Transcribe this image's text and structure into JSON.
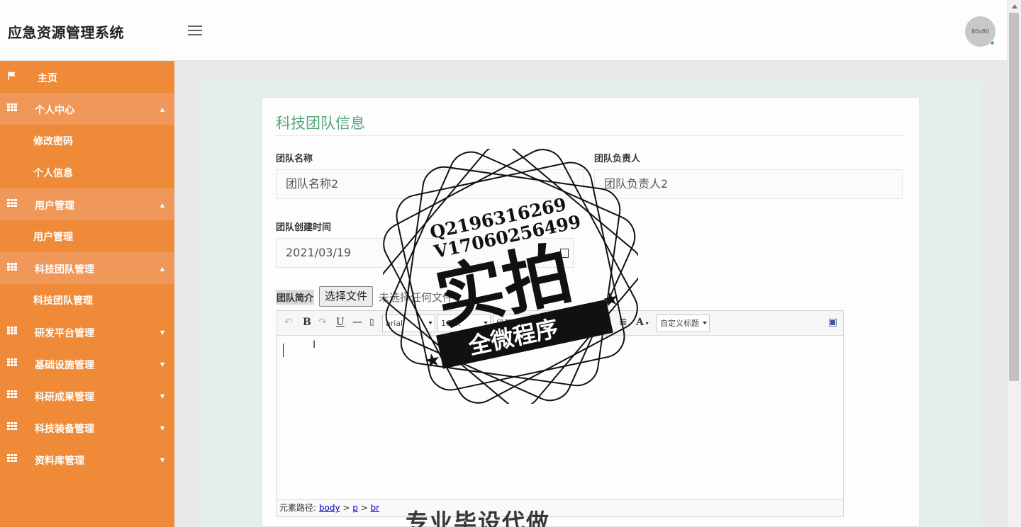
{
  "header": {
    "app_title": "应急资源管理系统",
    "avatar_text": "80x80"
  },
  "sidebar": {
    "items": [
      {
        "label": "主页",
        "icon": "flag-icon"
      },
      {
        "label": "个人中心",
        "icon": "grid-icon",
        "expanded": true,
        "children": [
          "修改密码",
          "个人信息"
        ]
      },
      {
        "label": "用户管理",
        "icon": "grid-icon",
        "expanded": true,
        "children": [
          "用户管理"
        ]
      },
      {
        "label": "科技团队管理",
        "icon": "grid-icon",
        "expanded": true,
        "children": [
          "科技团队管理"
        ]
      },
      {
        "label": "研发平台管理",
        "icon": "grid-icon"
      },
      {
        "label": "基础设施管理",
        "icon": "grid-icon"
      },
      {
        "label": "科研成果管理",
        "icon": "grid-icon"
      },
      {
        "label": "科技装备管理",
        "icon": "grid-icon"
      },
      {
        "label": "资料库管理",
        "icon": "grid-icon"
      }
    ]
  },
  "form": {
    "title": "科技团队信息",
    "team_name_label": "团队名称",
    "team_name_value": "团队名称2",
    "leader_label": "团队负责人",
    "leader_value": "团队负责人2",
    "created_label": "团队创建时间",
    "created_value": "2021/03/19",
    "intro_label": "团队简介",
    "file_button": "选择文件",
    "file_status": "未选择任何文件"
  },
  "editor": {
    "font_select": "arial",
    "size_select": "16px",
    "paragraph_select": "段落",
    "heading_select": "自定义标题",
    "path_label": "元素路径:",
    "path": [
      "body",
      "p",
      "br"
    ]
  },
  "watermark": {
    "line1": "Q2196316269",
    "line2": "V17060256499",
    "big": "实拍",
    "band": "全微程序",
    "bottom": "专业毕设代做"
  },
  "colors": {
    "sidebar": "#ee8a38",
    "accent_title": "#58a87a",
    "content_bg": "#e5efea"
  }
}
